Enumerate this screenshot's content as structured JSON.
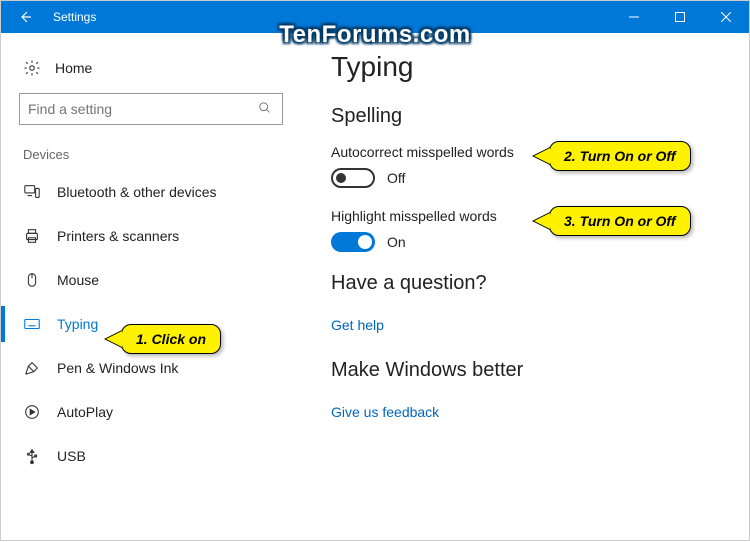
{
  "titlebar": {
    "title": "Settings"
  },
  "watermark": "TenForums.com",
  "sidebar": {
    "home": "Home",
    "search_placeholder": "Find a setting",
    "section": "Devices",
    "items": [
      {
        "label": "Bluetooth & other devices"
      },
      {
        "label": "Printers & scanners"
      },
      {
        "label": "Mouse"
      },
      {
        "label": "Typing"
      },
      {
        "label": "Pen & Windows Ink"
      },
      {
        "label": "AutoPlay"
      },
      {
        "label": "USB"
      }
    ]
  },
  "main": {
    "title": "Typing",
    "spelling_heading": "Spelling",
    "autocorrect_label": "Autocorrect misspelled words",
    "autocorrect_state": "Off",
    "highlight_label": "Highlight misspelled words",
    "highlight_state": "On",
    "question_heading": "Have a question?",
    "help_link": "Get help",
    "better_heading": "Make Windows better",
    "feedback_link": "Give us feedback"
  },
  "callouts": {
    "c1": "1. Click on",
    "c2": "2. Turn On or Off",
    "c3": "3. Turn On or Off"
  }
}
